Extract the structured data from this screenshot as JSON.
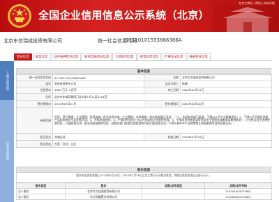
{
  "banner": {
    "title": "全国企业信用信息公示系统（北京）",
    "links": "北京工商局  |  帮助  |  网站导航"
  },
  "company": {
    "name": "北京东信瑞成投资有限公司",
    "credit_label": "统一社会信用代码：",
    "credit_code": "91110101593866386A"
  },
  "tabs": [
    {
      "label": "登记信息",
      "active": true
    },
    {
      "label": "备案信息",
      "active": false
    },
    {
      "label": "动产抵押登记信息",
      "active": false
    },
    {
      "label": "股权出质登记信息",
      "active": false
    },
    {
      "label": "行政处罚信息",
      "active": false
    },
    {
      "label": "经营异常信息",
      "active": false
    },
    {
      "label": "严重违法信息",
      "active": false
    },
    {
      "label": "抽查检查信息",
      "active": false
    }
  ],
  "sidebar": {
    "section1": "工商公示信息",
    "section2": "企业公示信息"
  },
  "basic": {
    "header": "基本信息",
    "rows": [
      {
        "l1": "统一社会信用代码",
        "v1": "91110101593866386A",
        "l2": "名称",
        "v2": "北京东信瑞成投资有限公司"
      },
      {
        "l1": "类型",
        "v1": "其他有限责任公司",
        "l2": "法定代表人",
        "v2": "杨博"
      },
      {
        "l1": "注册资本",
        "v1": "1000 万元 人民币",
        "l2": "成立日期",
        "v2": "2012年05月21日"
      }
    ],
    "address_label": "住所",
    "address": "北京市东城区朝阳门北大街1号11层1101室",
    "term_from_label": "营业期限自",
    "term_from": "2012年05月21日",
    "term_to_label": "营业期限至",
    "term_to": "2032年05月20日",
    "scope_label": "经营范围",
    "scope": "投资；资产管理；企业管理；投资咨询；经济信息咨询；企业策划；市场调查；承办展览展示活动。（“1、未经有关部门批准，不得以公开方式募集资金；2、不得公开开展证券类产品和金融衍生品交易活动；3、不得发放贷款；4、不得对所投资企业以外的其他企业提供担保；5、不得向投资者承诺投资本金不受损失或者承诺最低收益”；企业依法自主选择经营项目，开展经营活动；依法须经批准的项目，经相关部门批准后依批准的内容开展经营活动；不得从事本市产业政策禁止和限制类项目的经营活动。）",
    "authority_label": "登记机关",
    "authority": "东城分局",
    "approval_label": "核准日期",
    "approval": "2016年03月18日",
    "status_label": "登记状态",
    "status": "在营（开业）企业"
  },
  "shareholders": {
    "header": "股东信息",
    "note": "股东的出资信息截止2014年2月28日。2014年2月28日之后工商只公示股东姓名，其他出资信息由企业自行公示。",
    "columns": [
      "股东类型",
      "股东",
      "证照/证件类型",
      "证照/证件号码"
    ],
    "rows": [
      {
        "type": "法人股东",
        "name": "北京东方信通投资有限公司",
        "id_type": "",
        "id_no": "110101004075861"
      },
      {
        "type": "法人股东",
        "name": "东方财富置业有限公司",
        "id_type": "",
        "id_no": "110000001234621"
      }
    ]
  },
  "colors": {
    "banner_red": "#c81818",
    "tab_active": "#c71a1a",
    "side_dark": "#4f7dbd",
    "side_light": "#8db0dd"
  }
}
